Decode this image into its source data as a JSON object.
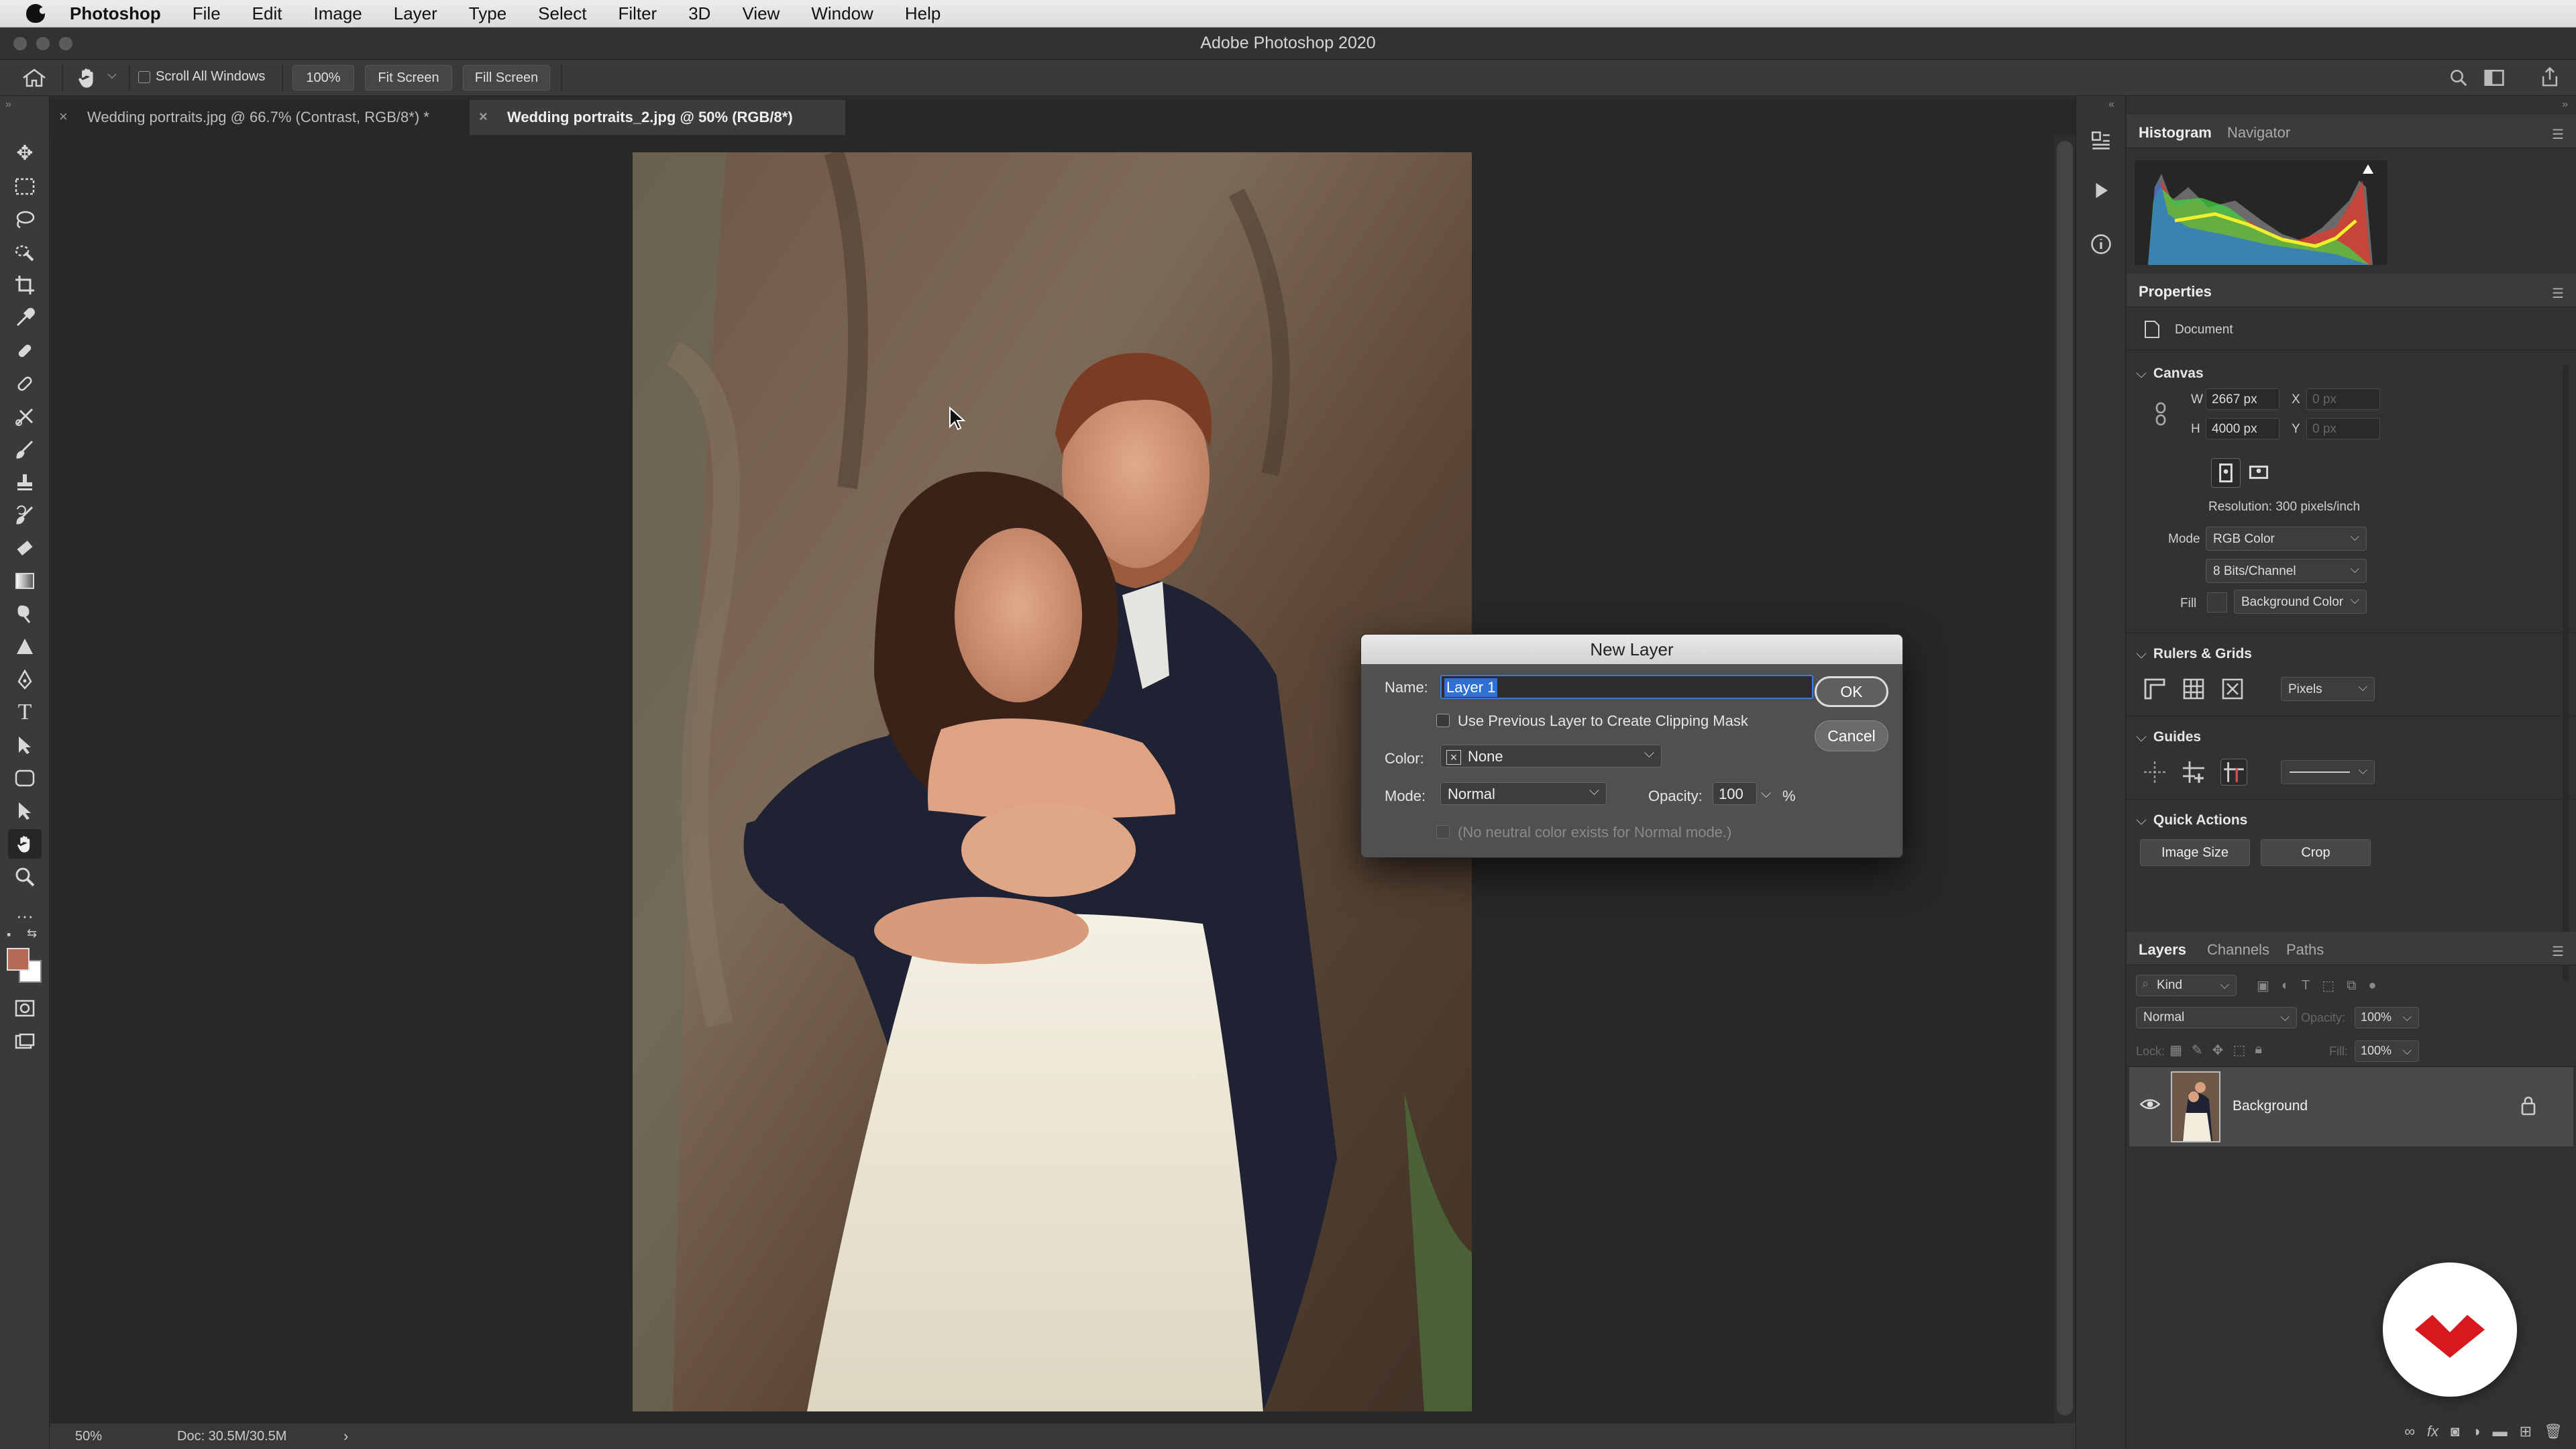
{
  "menubar": {
    "app_name": "Photoshop",
    "items": [
      "File",
      "Edit",
      "Image",
      "Layer",
      "Type",
      "Select",
      "Filter",
      "3D",
      "View",
      "Window",
      "Help"
    ]
  },
  "window": {
    "title": "Adobe Photoshop 2020"
  },
  "options_bar": {
    "scroll_all_windows": "Scroll All Windows",
    "zoom_button": "100%",
    "fit_screen": "Fit Screen",
    "fill_screen": "Fill Screen"
  },
  "tabs": [
    {
      "label": "Wedding portraits.jpg @ 66.7% (Contrast, RGB/8*) *",
      "active": false
    },
    {
      "label": "Wedding portraits_2.jpg @ 50% (RGB/8*)",
      "active": true
    }
  ],
  "status_bar": {
    "zoom": "50%",
    "doc": "Doc: 30.5M/30.5M",
    "arrow": "›"
  },
  "panels": {
    "top_tabs": [
      "Histogram",
      "Navigator"
    ],
    "properties_title": "Properties",
    "document_label": "Document",
    "canvas": {
      "title": "Canvas",
      "w_label": "W",
      "w_value": "2667 px",
      "h_label": "H",
      "h_value": "4000 px",
      "x_label": "X",
      "x_placeholder": "0 px",
      "y_label": "Y",
      "y_placeholder": "0 px",
      "resolution": "Resolution: 300 pixels/inch",
      "mode_label": "Mode",
      "mode_value": "RGB Color",
      "bits_value": "8 Bits/Channel",
      "fill_label": "Fill",
      "fill_value": "Background Color"
    },
    "rulers": {
      "title": "Rulers & Grids",
      "unit": "Pixels"
    },
    "guides": {
      "title": "Guides"
    },
    "quick_actions": {
      "title": "Quick Actions",
      "image_size": "Image Size",
      "crop": "Crop"
    },
    "layers": {
      "tabs": [
        "Layers",
        "Channels",
        "Paths"
      ],
      "filter_placeholder": "Kind",
      "blend_mode": "Normal",
      "opacity_label": "Opacity:",
      "opacity_value": "100%",
      "lock_label": "Lock:",
      "fill_label": "Fill:",
      "fill_value": "100%",
      "items": [
        {
          "name": "Background",
          "locked": true,
          "visible": true
        }
      ]
    }
  },
  "dialog": {
    "title": "New Layer",
    "name_label": "Name:",
    "name_value": "Layer 1",
    "clipping_label": "Use Previous Layer to Create Clipping Mask",
    "color_label": "Color:",
    "color_value": "None",
    "mode_label": "Mode:",
    "mode_value": "Normal",
    "opacity_label": "Opacity:",
    "opacity_value": "100",
    "percent": "%",
    "neutral_note": "(No neutral color exists for Normal mode.)",
    "ok": "OK",
    "cancel": "Cancel"
  },
  "colors": {
    "foreground": "#b46a55",
    "background": "#ffffff",
    "highlight": "#2f6fd6",
    "logo": "#d7191f"
  }
}
